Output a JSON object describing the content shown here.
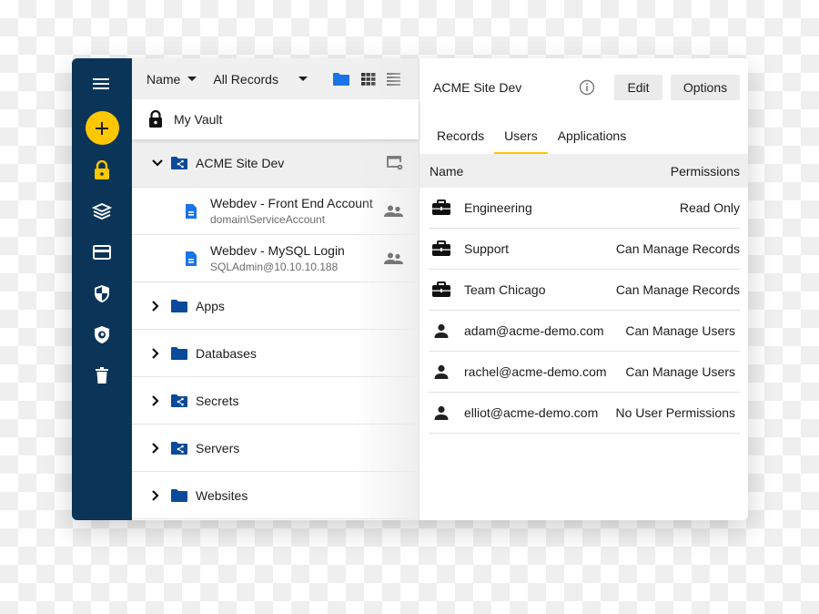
{
  "rail": {
    "items": [
      {
        "icon": "menu-icon"
      },
      {
        "icon": "add-icon"
      },
      {
        "icon": "lock-icon"
      },
      {
        "icon": "layers-icon"
      },
      {
        "icon": "credit-card-icon"
      },
      {
        "icon": "shield-icon"
      },
      {
        "icon": "security-shield-icon"
      },
      {
        "icon": "trash-icon"
      }
    ],
    "colors": {
      "background": "#0b3558",
      "accent": "#ffc700"
    }
  },
  "tree": {
    "toolbar": {
      "sort_label": "Name",
      "filter_label": "All Records"
    },
    "vault_label": "My Vault",
    "open_folder": {
      "name": "ACME Site Dev",
      "records": [
        {
          "title": "Webdev - Front End Account",
          "subtitle": "domain\\ServiceAccount"
        },
        {
          "title": "Webdev - MySQL Login",
          "subtitle": "SQLAdmin@10.10.10.188"
        }
      ]
    },
    "folders": [
      {
        "name": "Apps",
        "shared": false
      },
      {
        "name": "Databases",
        "shared": false
      },
      {
        "name": "Secrets",
        "shared": true
      },
      {
        "name": "Servers",
        "shared": true
      },
      {
        "name": "Websites",
        "shared": false
      }
    ],
    "colors": {
      "folder": "#0a4a9a",
      "record": "#1a73e8"
    }
  },
  "detail": {
    "title": "ACME Site Dev",
    "edit_label": "Edit",
    "options_label": "Options",
    "tabs": [
      {
        "label": "Records",
        "active": false
      },
      {
        "label": "Users",
        "active": true
      },
      {
        "label": "Applications",
        "active": false
      }
    ],
    "table": {
      "col_name": "Name",
      "col_permissions": "Permissions",
      "rows": [
        {
          "type": "team",
          "name": "Engineering",
          "permission": "Read Only"
        },
        {
          "type": "team",
          "name": "Support",
          "permission": "Can Manage Records"
        },
        {
          "type": "team",
          "name": "Team Chicago",
          "permission": "Can Manage Records"
        },
        {
          "type": "user",
          "name": "adam@acme-demo.com",
          "permission": "Can Manage Users"
        },
        {
          "type": "user",
          "name": "rachel@acme-demo.com",
          "permission": "Can Manage Users"
        },
        {
          "type": "user",
          "name": "elliot@acme-demo.com",
          "permission": "No User Permissions"
        }
      ]
    }
  }
}
